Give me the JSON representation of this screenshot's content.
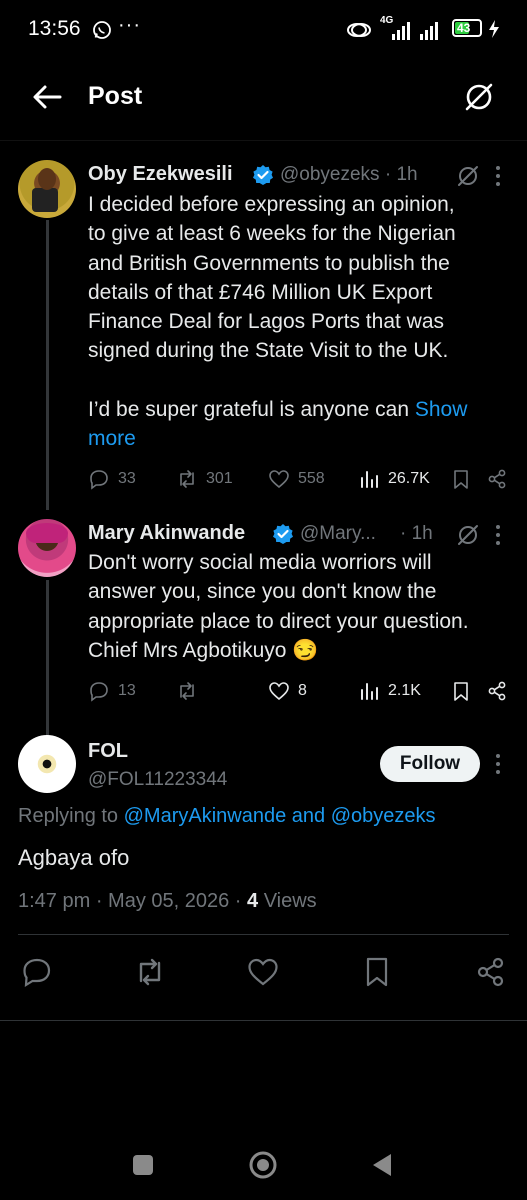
{
  "status_bar": {
    "time": "13:56",
    "more": "···",
    "network": "4G",
    "battery": "43"
  },
  "header": {
    "title": "Post"
  },
  "tweet1": {
    "name": "Oby Ezekwesili",
    "handle": "@obyezeks · 1h",
    "body_lines": [
      "I decided before expressing an opinion,",
      "to give at least 6 weeks for the Nigerian",
      "and British Governments to publish the",
      "details of that £746 Million UK Export",
      "Finance Deal for Lagos Ports that was",
      "signed during the State Visit to the UK."
    ],
    "body_last": "I’d be super grateful is anyone can ",
    "show_more_1": "Show",
    "show_more_2": "more",
    "replies": "33",
    "reposts": "301",
    "likes": "558",
    "views": "26.7K"
  },
  "tweet2": {
    "name": "Mary Akinwande",
    "handle": "@Mary...",
    "time": "· 1h",
    "body_lines": [
      "Don't worry social media worriors will",
      "answer you, since you don't know the",
      "appropriate place to direct your question.",
      "Chief Mrs Agbotikuyo 😏"
    ],
    "replies": "13",
    "reposts": "",
    "likes": "8",
    "views": "2.1K"
  },
  "main_tweet": {
    "name": "FOL",
    "handle": "@FOL11223344",
    "follow_label": "Follow",
    "replying_prefix": "Replying to ",
    "replying_handles": "@MaryAkinwande and @obyezeks",
    "text": "Agbaya ofo",
    "timestamp": "1:47 pm · May 05, 2026 · ",
    "views_count": "4",
    "views_label": " Views"
  },
  "colors": {
    "background": "#000000",
    "accent": "#1d9bf0",
    "muted": "#71767b",
    "text": "#e7e9ea"
  }
}
